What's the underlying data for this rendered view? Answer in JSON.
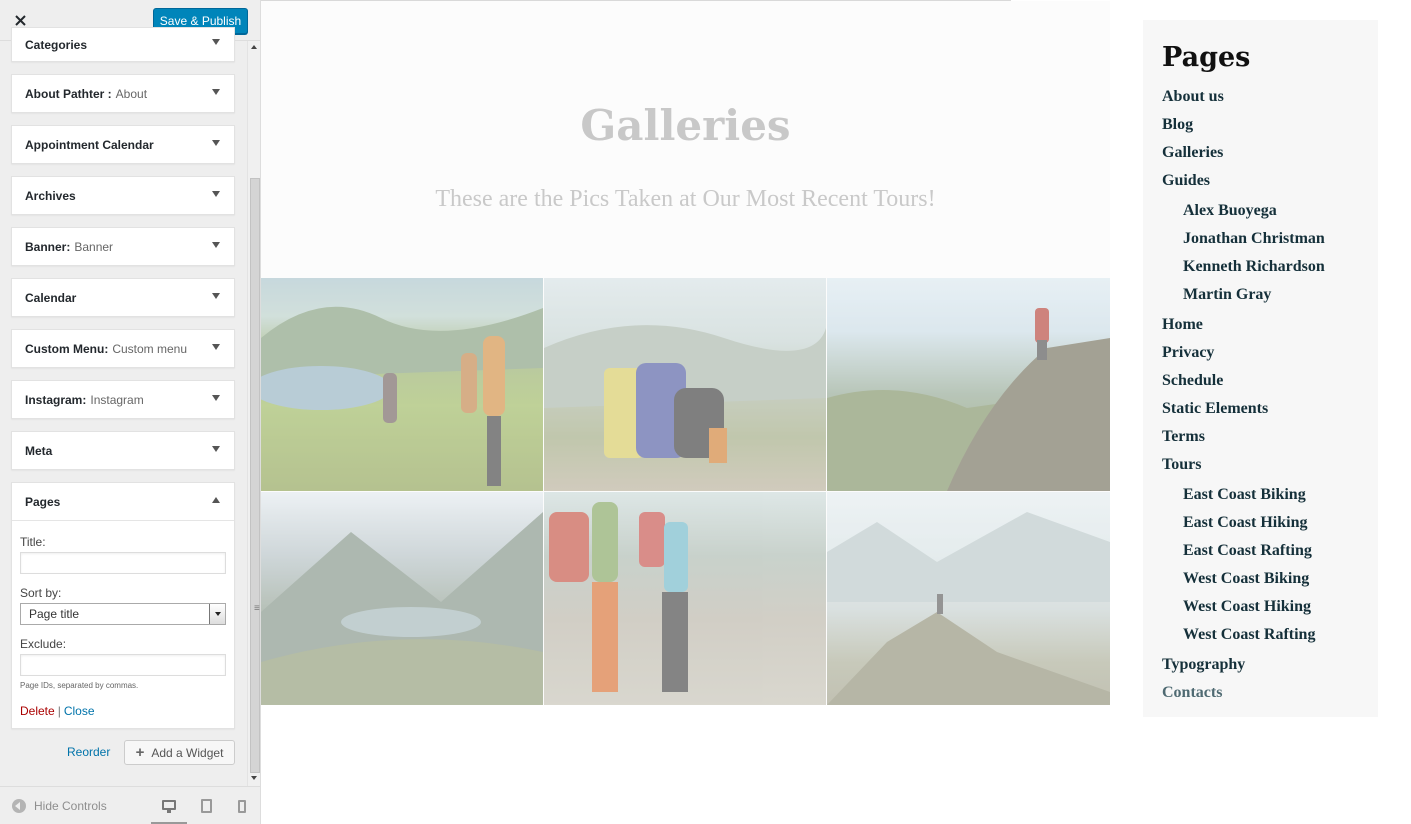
{
  "header": {
    "close_icon": "close-icon",
    "save_label": "Save & Publish"
  },
  "widgets": [
    {
      "name": "Categories",
      "title": ""
    },
    {
      "name": "About Pathter :",
      "title": "About"
    },
    {
      "name": "Appointment Calendar",
      "title": ""
    },
    {
      "name": "Archives",
      "title": ""
    },
    {
      "name": "Banner:",
      "title": "Banner"
    },
    {
      "name": "Calendar",
      "title": ""
    },
    {
      "name": "Custom Menu:",
      "title": "Custom menu"
    },
    {
      "name": "Instagram:",
      "title": "Instagram"
    },
    {
      "name": "Meta",
      "title": ""
    },
    {
      "name": "Pages",
      "title": ""
    }
  ],
  "pages_form": {
    "title_label": "Title:",
    "title_value": "",
    "sortby_label": "Sort by:",
    "sortby_value": "Page title",
    "exclude_label": "Exclude:",
    "exclude_value": "",
    "help": "Page IDs, separated by commas.",
    "delete_label": "Delete",
    "separator": "|",
    "close_label": "Close"
  },
  "reorder_label": "Reorder",
  "add_widget_label": "Add a Widget",
  "footer": {
    "hide_controls_label": "Hide Controls"
  },
  "preview": {
    "heading": "Galleries",
    "subtitle": "These are the Pics Taken at Our Most Recent Tours!",
    "sidebar_title": "Pages",
    "pages": [
      {
        "label": "About us",
        "level": 0
      },
      {
        "label": "Blog",
        "level": 0
      },
      {
        "label": "Galleries",
        "level": 0
      },
      {
        "label": "Guides",
        "level": 0
      },
      {
        "label": "Alex Buoyega",
        "level": 1
      },
      {
        "label": "Jonathan Christman",
        "level": 1
      },
      {
        "label": "Kenneth Richardson",
        "level": 1
      },
      {
        "label": "Martin Gray",
        "level": 1
      },
      {
        "label": "Home",
        "level": 0
      },
      {
        "label": "Privacy",
        "level": 0
      },
      {
        "label": "Schedule",
        "level": 0
      },
      {
        "label": "Static Elements",
        "level": 0
      },
      {
        "label": "Terms",
        "level": 0
      },
      {
        "label": "Tours",
        "level": 0
      },
      {
        "label": "East Coast Biking",
        "level": 1
      },
      {
        "label": "East Coast Hiking",
        "level": 1
      },
      {
        "label": "East Coast Rafting",
        "level": 1
      },
      {
        "label": "West Coast Biking",
        "level": 1
      },
      {
        "label": "West Coast Hiking",
        "level": 1
      },
      {
        "label": "West Coast Rafting",
        "level": 1
      },
      {
        "label": "Typography",
        "level": 0
      },
      {
        "label": "Contacts",
        "level": 0
      }
    ]
  },
  "colors": {
    "primary": "#0085ba",
    "link": "#0073aa",
    "delete": "#a00000",
    "page_link": "#15303a"
  }
}
